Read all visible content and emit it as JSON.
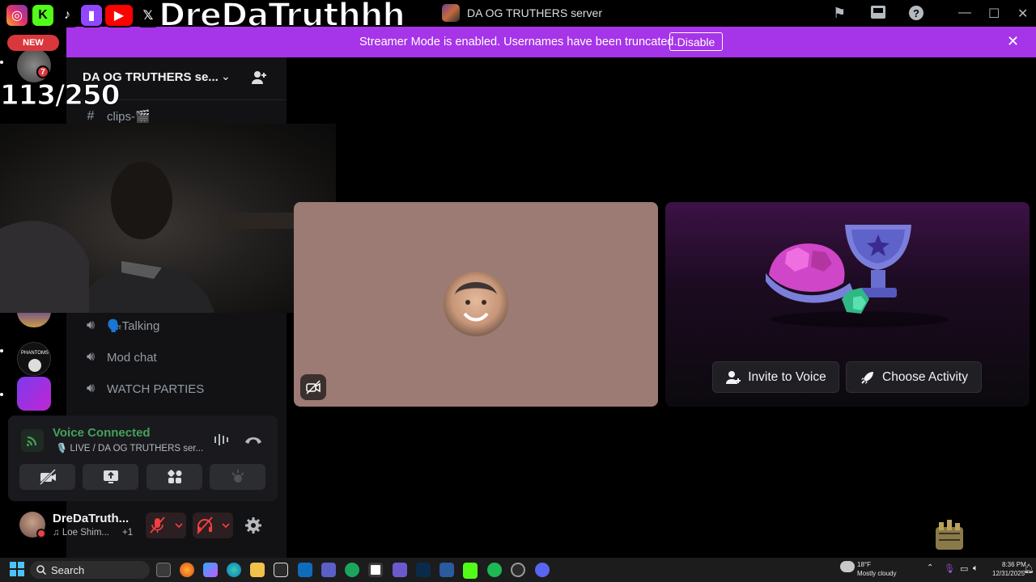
{
  "window": {
    "title": "DA OG TRUTHERS server"
  },
  "overlay": {
    "streamer_name": "DreDaTruthhh",
    "new_badge": "NEW",
    "counter": "113/250",
    "notification_count": "7",
    "social_icons": [
      "instagram-icon",
      "kick-icon",
      "tiktok-icon",
      "twitch-icon",
      "youtube-icon",
      "x-icon"
    ]
  },
  "banner": {
    "text": "Streamer Mode is enabled. Usernames have been truncated.",
    "button": "Disable"
  },
  "sidebar": {
    "server_name": "DA OG TRUTHERS se...",
    "channels": [
      {
        "name": "clips-🎬",
        "type": "text"
      },
      {
        "name": "🗣️Talking",
        "type": "voice"
      },
      {
        "name": "Mod chat",
        "type": "voice"
      },
      {
        "name": "WATCH PARTIES",
        "type": "voice"
      }
    ]
  },
  "voice": {
    "status": "Voice Connected",
    "channel": "🎙️ LIVE / DA OG TRUTHERS ser..."
  },
  "user": {
    "name": "DreDaTruth...",
    "status": "♫ Loe Shim...",
    "extra": "+1"
  },
  "activity": {
    "invite_label": "Invite to Voice",
    "choose_label": "Choose Activity"
  },
  "taskbar": {
    "search_label": "Search",
    "weather_temp": "18°F",
    "weather_desc": "Mostly cloudy",
    "time": "8:36 PM",
    "date": "12/31/2025"
  }
}
